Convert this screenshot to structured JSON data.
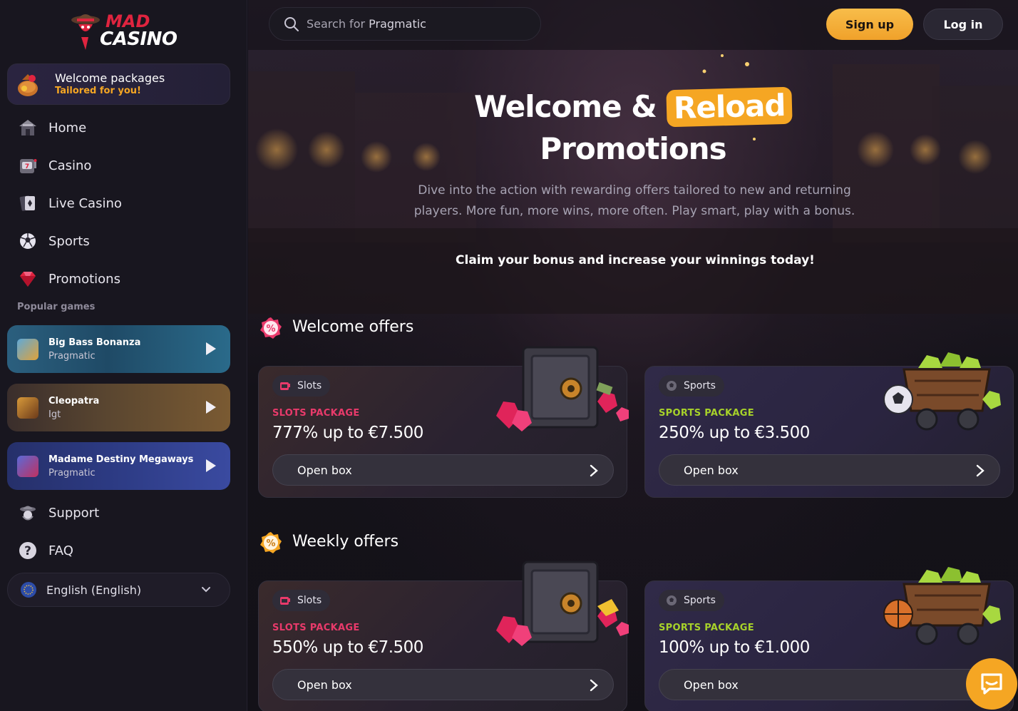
{
  "brand": {
    "line1": "MAD",
    "line2": "CASINO"
  },
  "welcome_pack": {
    "title": "Welcome packages",
    "subtitle": "Tailored for you!"
  },
  "nav": [
    {
      "label": "Home",
      "icon": "home-icon"
    },
    {
      "label": "Casino",
      "icon": "slot-machine-icon"
    },
    {
      "label": "Live Casino",
      "icon": "cards-icon"
    },
    {
      "label": "Sports",
      "icon": "soccer-ball-icon"
    },
    {
      "label": "Promotions",
      "icon": "gem-icon"
    }
  ],
  "popular": {
    "heading": "Popular games",
    "games": [
      {
        "name": "Big Bass Bonanza",
        "provider": "Pragmatic"
      },
      {
        "name": "Cleopatra",
        "provider": "Igt"
      },
      {
        "name": "Madame Destiny Megaways",
        "provider": "Pragmatic"
      }
    ]
  },
  "nav_bottom": [
    {
      "label": "Support",
      "icon": "support-icon"
    },
    {
      "label": "FAQ",
      "icon": "question-icon"
    }
  ],
  "language": {
    "label": "English (English)"
  },
  "search": {
    "prefix": "Search for ",
    "term": "Pragmatic"
  },
  "header": {
    "signup": "Sign up",
    "login": "Log in"
  },
  "hero": {
    "title_a": "Welcome & ",
    "title_badge": "Reload",
    "title_b": "Promotions",
    "description": "Dive into the action with rewarding offers tailored to new and returning players. More fun, more wins, more often. Play smart, play with a bonus.",
    "claim": "Claim your bonus and increase your winnings today!"
  },
  "sections": {
    "welcome": {
      "title": "Welcome offers",
      "cards": [
        {
          "tag": "Slots",
          "package": "SLOTS PACKAGE",
          "amount": "777% up to €7.500",
          "button": "Open box"
        },
        {
          "tag": "Sports",
          "package": "SPORTS PACKAGE",
          "amount": "250% up to €3.500",
          "button": "Open box"
        }
      ]
    },
    "weekly": {
      "title": "Weekly offers",
      "cards": [
        {
          "tag": "Slots",
          "package": "SLOTS PACKAGE",
          "amount": "550% up to €7.500",
          "button": "Open box"
        },
        {
          "tag": "Sports",
          "package": "SPORTS PACKAGE",
          "amount": "100% up to €1.000",
          "button": "Open box"
        }
      ]
    }
  },
  "colors": {
    "accent": "#f5a623",
    "slots": "#e93a6b",
    "sports": "#a7d22a"
  }
}
